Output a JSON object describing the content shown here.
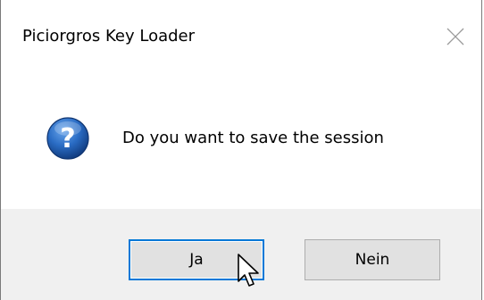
{
  "window": {
    "title": "Piciorgros Key Loader",
    "close_icon": "close-icon"
  },
  "message": {
    "icon": "question-icon",
    "text": "Do you want to save the session"
  },
  "buttons": {
    "yes_label": "Ja",
    "no_label": "Nein"
  },
  "colors": {
    "accent": "#0078d7",
    "icon_blue": "#1f5fae",
    "footer_bg": "#f0f0f0"
  }
}
